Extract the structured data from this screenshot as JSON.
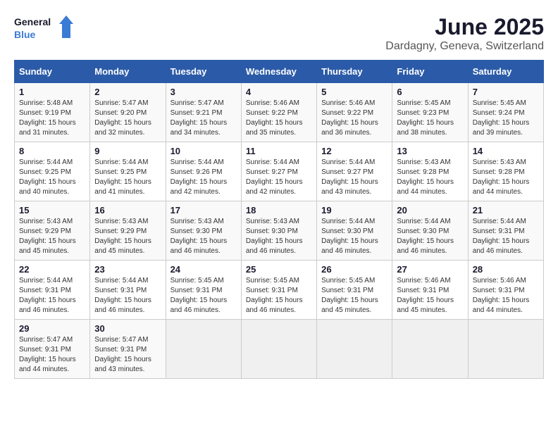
{
  "logo": {
    "line1": "General",
    "line2": "Blue"
  },
  "title": "June 2025",
  "subtitle": "Dardagny, Geneva, Switzerland",
  "weekdays": [
    "Sunday",
    "Monday",
    "Tuesday",
    "Wednesday",
    "Thursday",
    "Friday",
    "Saturday"
  ],
  "weeks": [
    [
      {
        "day": "1",
        "sunrise": "Sunrise: 5:48 AM",
        "sunset": "Sunset: 9:19 PM",
        "daylight": "Daylight: 15 hours and 31 minutes."
      },
      {
        "day": "2",
        "sunrise": "Sunrise: 5:47 AM",
        "sunset": "Sunset: 9:20 PM",
        "daylight": "Daylight: 15 hours and 32 minutes."
      },
      {
        "day": "3",
        "sunrise": "Sunrise: 5:47 AM",
        "sunset": "Sunset: 9:21 PM",
        "daylight": "Daylight: 15 hours and 34 minutes."
      },
      {
        "day": "4",
        "sunrise": "Sunrise: 5:46 AM",
        "sunset": "Sunset: 9:22 PM",
        "daylight": "Daylight: 15 hours and 35 minutes."
      },
      {
        "day": "5",
        "sunrise": "Sunrise: 5:46 AM",
        "sunset": "Sunset: 9:22 PM",
        "daylight": "Daylight: 15 hours and 36 minutes."
      },
      {
        "day": "6",
        "sunrise": "Sunrise: 5:45 AM",
        "sunset": "Sunset: 9:23 PM",
        "daylight": "Daylight: 15 hours and 38 minutes."
      },
      {
        "day": "7",
        "sunrise": "Sunrise: 5:45 AM",
        "sunset": "Sunset: 9:24 PM",
        "daylight": "Daylight: 15 hours and 39 minutes."
      }
    ],
    [
      {
        "day": "8",
        "sunrise": "Sunrise: 5:44 AM",
        "sunset": "Sunset: 9:25 PM",
        "daylight": "Daylight: 15 hours and 40 minutes."
      },
      {
        "day": "9",
        "sunrise": "Sunrise: 5:44 AM",
        "sunset": "Sunset: 9:25 PM",
        "daylight": "Daylight: 15 hours and 41 minutes."
      },
      {
        "day": "10",
        "sunrise": "Sunrise: 5:44 AM",
        "sunset": "Sunset: 9:26 PM",
        "daylight": "Daylight: 15 hours and 42 minutes."
      },
      {
        "day": "11",
        "sunrise": "Sunrise: 5:44 AM",
        "sunset": "Sunset: 9:27 PM",
        "daylight": "Daylight: 15 hours and 42 minutes."
      },
      {
        "day": "12",
        "sunrise": "Sunrise: 5:44 AM",
        "sunset": "Sunset: 9:27 PM",
        "daylight": "Daylight: 15 hours and 43 minutes."
      },
      {
        "day": "13",
        "sunrise": "Sunrise: 5:43 AM",
        "sunset": "Sunset: 9:28 PM",
        "daylight": "Daylight: 15 hours and 44 minutes."
      },
      {
        "day": "14",
        "sunrise": "Sunrise: 5:43 AM",
        "sunset": "Sunset: 9:28 PM",
        "daylight": "Daylight: 15 hours and 44 minutes."
      }
    ],
    [
      {
        "day": "15",
        "sunrise": "Sunrise: 5:43 AM",
        "sunset": "Sunset: 9:29 PM",
        "daylight": "Daylight: 15 hours and 45 minutes."
      },
      {
        "day": "16",
        "sunrise": "Sunrise: 5:43 AM",
        "sunset": "Sunset: 9:29 PM",
        "daylight": "Daylight: 15 hours and 45 minutes."
      },
      {
        "day": "17",
        "sunrise": "Sunrise: 5:43 AM",
        "sunset": "Sunset: 9:30 PM",
        "daylight": "Daylight: 15 hours and 46 minutes."
      },
      {
        "day": "18",
        "sunrise": "Sunrise: 5:43 AM",
        "sunset": "Sunset: 9:30 PM",
        "daylight": "Daylight: 15 hours and 46 minutes."
      },
      {
        "day": "19",
        "sunrise": "Sunrise: 5:44 AM",
        "sunset": "Sunset: 9:30 PM",
        "daylight": "Daylight: 15 hours and 46 minutes."
      },
      {
        "day": "20",
        "sunrise": "Sunrise: 5:44 AM",
        "sunset": "Sunset: 9:30 PM",
        "daylight": "Daylight: 15 hours and 46 minutes."
      },
      {
        "day": "21",
        "sunrise": "Sunrise: 5:44 AM",
        "sunset": "Sunset: 9:31 PM",
        "daylight": "Daylight: 15 hours and 46 minutes."
      }
    ],
    [
      {
        "day": "22",
        "sunrise": "Sunrise: 5:44 AM",
        "sunset": "Sunset: 9:31 PM",
        "daylight": "Daylight: 15 hours and 46 minutes."
      },
      {
        "day": "23",
        "sunrise": "Sunrise: 5:44 AM",
        "sunset": "Sunset: 9:31 PM",
        "daylight": "Daylight: 15 hours and 46 minutes."
      },
      {
        "day": "24",
        "sunrise": "Sunrise: 5:45 AM",
        "sunset": "Sunset: 9:31 PM",
        "daylight": "Daylight: 15 hours and 46 minutes."
      },
      {
        "day": "25",
        "sunrise": "Sunrise: 5:45 AM",
        "sunset": "Sunset: 9:31 PM",
        "daylight": "Daylight: 15 hours and 46 minutes."
      },
      {
        "day": "26",
        "sunrise": "Sunrise: 5:45 AM",
        "sunset": "Sunset: 9:31 PM",
        "daylight": "Daylight: 15 hours and 45 minutes."
      },
      {
        "day": "27",
        "sunrise": "Sunrise: 5:46 AM",
        "sunset": "Sunset: 9:31 PM",
        "daylight": "Daylight: 15 hours and 45 minutes."
      },
      {
        "day": "28",
        "sunrise": "Sunrise: 5:46 AM",
        "sunset": "Sunset: 9:31 PM",
        "daylight": "Daylight: 15 hours and 44 minutes."
      }
    ],
    [
      {
        "day": "29",
        "sunrise": "Sunrise: 5:47 AM",
        "sunset": "Sunset: 9:31 PM",
        "daylight": "Daylight: 15 hours and 44 minutes."
      },
      {
        "day": "30",
        "sunrise": "Sunrise: 5:47 AM",
        "sunset": "Sunset: 9:31 PM",
        "daylight": "Daylight: 15 hours and 43 minutes."
      },
      null,
      null,
      null,
      null,
      null
    ]
  ]
}
